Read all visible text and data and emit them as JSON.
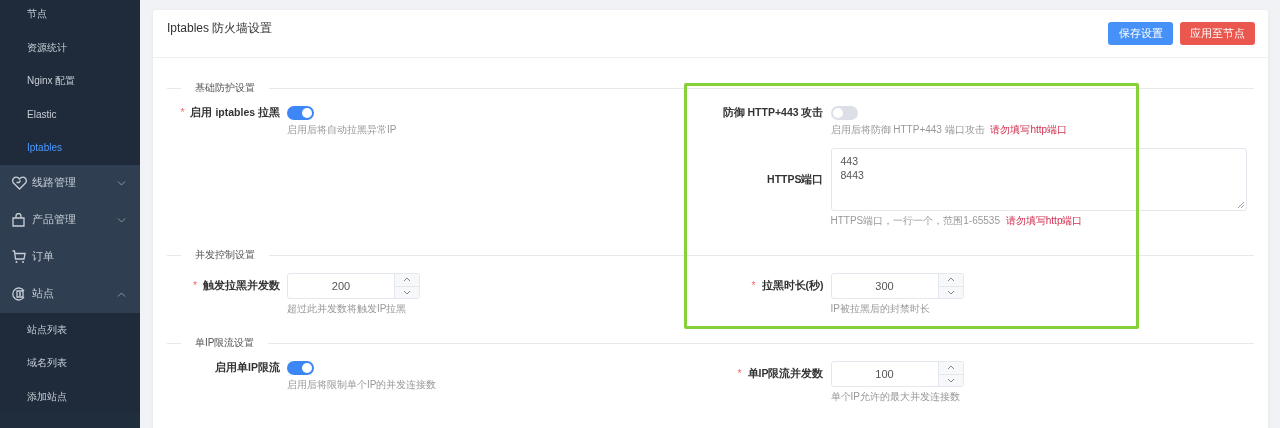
{
  "sidebar": {
    "items": [
      {
        "kind": "sub",
        "label": "节点",
        "selected": false
      },
      {
        "kind": "sub",
        "label": "资源统计",
        "selected": false
      },
      {
        "kind": "sub",
        "label": "Nginx 配置",
        "selected": false
      },
      {
        "kind": "sub",
        "label": "Elastic",
        "selected": false
      },
      {
        "kind": "sub",
        "label": "Iptables",
        "selected": true
      },
      {
        "kind": "group",
        "label": "线路管理",
        "expanded": false
      },
      {
        "kind": "group",
        "label": "产品管理",
        "expanded": false
      },
      {
        "kind": "group",
        "label": "订单"
      },
      {
        "kind": "group",
        "label": "站点",
        "expanded": true
      },
      {
        "kind": "sub",
        "label": "站点列表",
        "selected": false
      },
      {
        "kind": "sub",
        "label": "域名列表",
        "selected": false
      },
      {
        "kind": "sub",
        "label": "添加站点",
        "selected": false
      }
    ]
  },
  "header": {
    "title": "Iptables 防火墙设置",
    "buttons": [
      {
        "label": "保存设置",
        "kind": "primary"
      },
      {
        "label": "应用至节点",
        "kind": "danger"
      }
    ]
  },
  "sections": [
    {
      "title": "基础防护设置",
      "left": [
        {
          "kind": "toggle",
          "label": "启用 iptables 拉黑",
          "required_mark": "*",
          "on": true,
          "help": "启用后将自动拉黑异常IP"
        }
      ],
      "right": [
        {
          "kind": "toggle",
          "label": "防御 HTTP+443 攻击",
          "on": false,
          "help": "启用后将防御 HTTP+443 端口攻击",
          "warning": "请勿填写http端口"
        },
        {
          "kind": "textarea",
          "label": "HTTPS端口",
          "lines": [
            "443",
            "8443"
          ],
          "help": "HTTPS端口，一行一个，范围1-65535",
          "warning": "请勿填写http端口"
        }
      ]
    },
    {
      "title": "并发控制设置",
      "left": [
        {
          "kind": "number",
          "label": "触发拉黑并发数",
          "required_mark": "*",
          "value": "200",
          "help": "超过此并发数将触发IP拉黑"
        }
      ],
      "right": [
        {
          "kind": "number",
          "label": "拉黑时长(秒)",
          "required_mark": "*",
          "value": "300",
          "help": "IP被拉黑后的封禁时长"
        }
      ]
    },
    {
      "title": "单IP限流设置",
      "left": [
        {
          "kind": "toggle",
          "label": "启用单IP限流",
          "on": true,
          "help": "启用后将限制单个IP的并发连接数"
        }
      ],
      "right": [
        {
          "kind": "number",
          "label": "单IP限流并发数",
          "required_mark": "*",
          "value": "100",
          "help": "单个IP允许的最大并发连接数"
        }
      ]
    }
  ]
}
